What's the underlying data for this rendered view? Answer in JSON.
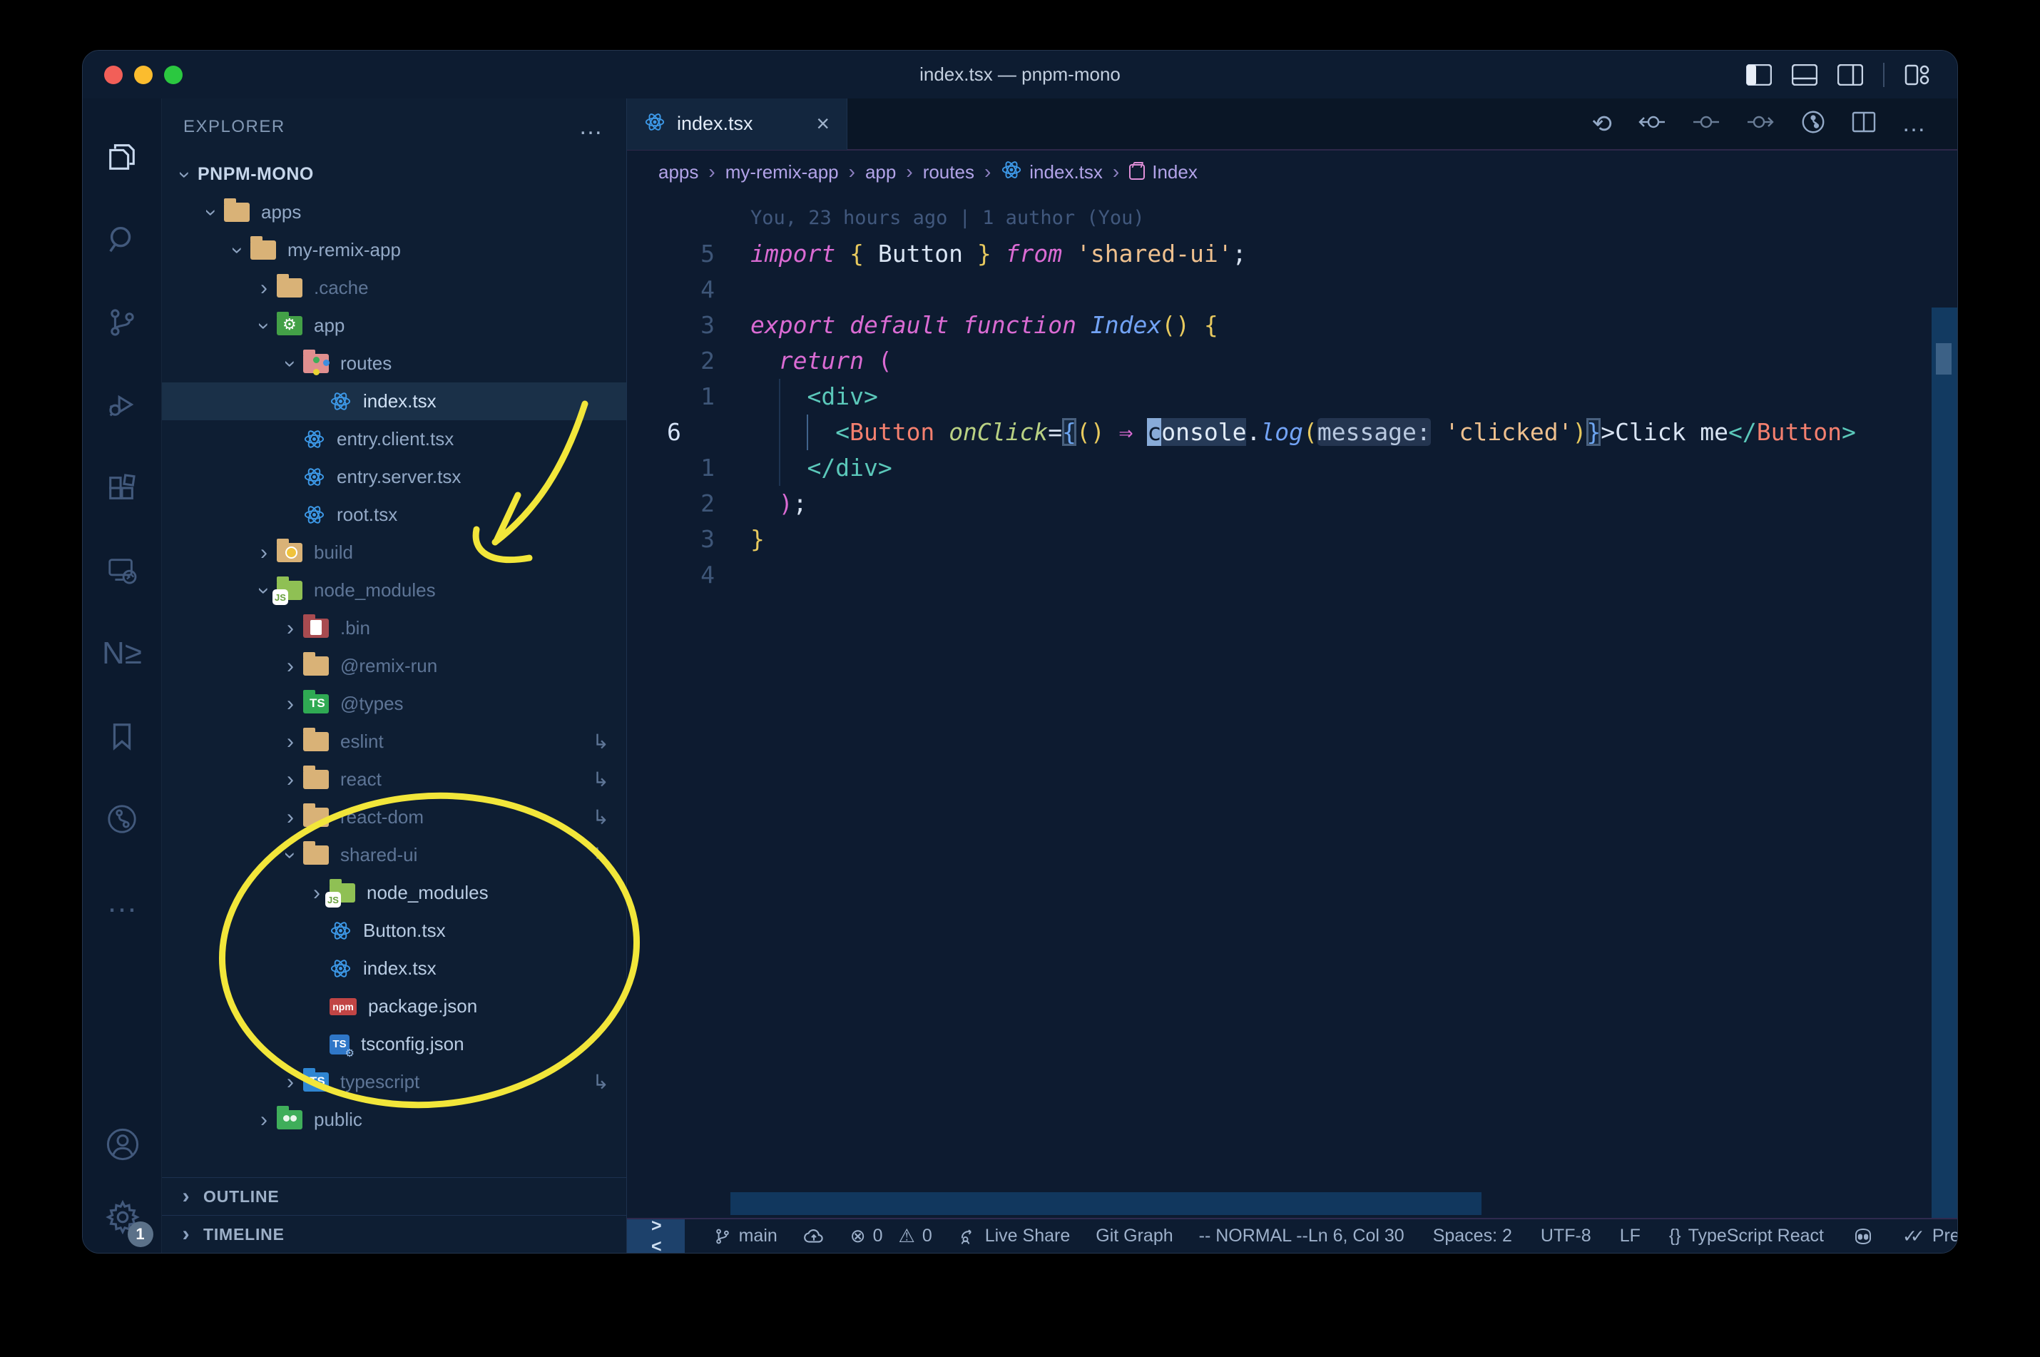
{
  "window": {
    "title": "index.tsx — pnpm-mono"
  },
  "colors": {
    "annotation": "#f2e63a",
    "accent_blue": "#3d99e8",
    "selection": "#1a3048",
    "status_bg": "#0d1c31"
  },
  "icons": {
    "chevron": "›",
    "close": "×",
    "more": "…",
    "more_dots": "…",
    "symlink": "↳",
    "error": "⊗",
    "warning": "⚠",
    "braces": "{}",
    "checks": "✓✓",
    "nx": "N≥",
    "gear": "⚙",
    "js_badge": "JS",
    "ts_badge": "TS",
    "npm_badge": "npm",
    "bin_badge": "0110",
    "history": "⟲"
  },
  "activity": {
    "badge": "1"
  },
  "explorer": {
    "header": "EXPLORER",
    "sections": [
      {
        "label": "OUTLINE"
      },
      {
        "label": "TIMELINE"
      }
    ],
    "items": [
      {
        "label": "PNPM-MONO",
        "icon": "none",
        "level": 0,
        "chevron": "open",
        "root": true
      },
      {
        "label": "apps",
        "icon": "folder-tan",
        "level": 1,
        "chevron": "open"
      },
      {
        "label": "my-remix-app",
        "icon": "folder-tan",
        "level": 2,
        "chevron": "open"
      },
      {
        "label": ".cache",
        "icon": "folder-tan",
        "level": 3,
        "chevron": "closed",
        "dim": true
      },
      {
        "label": "app",
        "icon": "folder-app",
        "level": 3,
        "chevron": "open"
      },
      {
        "label": "routes",
        "icon": "folder-routes",
        "level": 4,
        "chevron": "open"
      },
      {
        "label": "index.tsx",
        "icon": "react",
        "level": 5,
        "chevron": "none",
        "selected": true
      },
      {
        "label": "entry.client.tsx",
        "icon": "react",
        "level": 4,
        "chevron": "none"
      },
      {
        "label": "entry.server.tsx",
        "icon": "react",
        "level": 4,
        "chevron": "none"
      },
      {
        "label": "root.tsx",
        "icon": "react",
        "level": 4,
        "chevron": "none"
      },
      {
        "label": "build",
        "icon": "folder-dist",
        "level": 3,
        "chevron": "closed",
        "dim": true
      },
      {
        "label": "node_modules",
        "icon": "folder-js",
        "level": 3,
        "chevron": "open",
        "dim": true
      },
      {
        "label": ".bin",
        "icon": "folder-bin",
        "level": 4,
        "chevron": "closed",
        "dim": true
      },
      {
        "label": "@remix-run",
        "icon": "folder-tan",
        "level": 4,
        "chevron": "closed",
        "dim": true
      },
      {
        "label": "@types",
        "icon": "folder-ts-green",
        "level": 4,
        "chevron": "closed",
        "dim": true
      },
      {
        "label": "eslint",
        "icon": "folder-tan",
        "level": 4,
        "chevron": "closed",
        "dim": true,
        "symlink": true
      },
      {
        "label": "react",
        "icon": "folder-tan",
        "level": 4,
        "chevron": "closed",
        "dim": true,
        "symlink": true
      },
      {
        "label": "react-dom",
        "icon": "folder-tan",
        "level": 4,
        "chevron": "closed",
        "dim": true,
        "symlink": true
      },
      {
        "label": "shared-ui",
        "icon": "folder-tan",
        "level": 4,
        "chevron": "open",
        "dim": true,
        "symlink": true
      },
      {
        "label": "node_modules",
        "icon": "folder-js",
        "level": 5,
        "chevron": "closed",
        "bright": true
      },
      {
        "label": "Button.tsx",
        "icon": "react",
        "level": 5,
        "chevron": "none",
        "bright": true
      },
      {
        "label": "index.tsx",
        "icon": "react",
        "level": 5,
        "chevron": "none",
        "bright": true
      },
      {
        "label": "package.json",
        "icon": "npm",
        "level": 5,
        "chevron": "none",
        "bright": true
      },
      {
        "label": "tsconfig.json",
        "icon": "tsconfig",
        "level": 5,
        "chevron": "none",
        "bright": true
      },
      {
        "label": "typescript",
        "icon": "folder-ts-blue",
        "level": 4,
        "chevron": "closed",
        "dim": true,
        "symlink": true
      },
      {
        "label": "public",
        "icon": "folder-public",
        "level": 3,
        "chevron": "closed"
      }
    ]
  },
  "editor": {
    "tab": {
      "label": "index.tsx"
    },
    "breadcrumbs": [
      {
        "label": "apps"
      },
      {
        "label": "my-remix-app"
      },
      {
        "label": "app"
      },
      {
        "label": "routes"
      },
      {
        "label": "index.tsx",
        "icon": "react"
      },
      {
        "label": "Index",
        "icon": "symbol"
      }
    ],
    "code": {
      "blame": "You, 23 hours ago | 1 author (You)",
      "lines": [
        {
          "g": "5",
          "tokens": [
            {
              "c": "kw",
              "t": "import"
            },
            {
              "c": "pl",
              "t": " "
            },
            {
              "c": "yb",
              "t": "{"
            },
            {
              "c": "pl",
              "t": " Button "
            },
            {
              "c": "yb",
              "t": "}"
            },
            {
              "c": "pl",
              "t": " "
            },
            {
              "c": "kw",
              "t": "from"
            },
            {
              "c": "pl",
              "t": " "
            },
            {
              "c": "str",
              "t": "'shared-ui'"
            },
            {
              "c": "pl",
              "t": ";"
            }
          ]
        },
        {
          "g": "4",
          "tokens": []
        },
        {
          "g": "3",
          "tokens": [
            {
              "c": "kw",
              "t": "export"
            },
            {
              "c": "pl",
              "t": " "
            },
            {
              "c": "kw",
              "t": "default"
            },
            {
              "c": "pl",
              "t": " "
            },
            {
              "c": "kw",
              "t": "function"
            },
            {
              "c": "pl",
              "t": " "
            },
            {
              "c": "fn",
              "t": "Index"
            },
            {
              "c": "yb",
              "t": "()"
            },
            {
              "c": "pl",
              "t": " "
            },
            {
              "c": "yb",
              "t": "{"
            }
          ]
        },
        {
          "g": "2",
          "tokens": [
            {
              "c": "pl",
              "t": "  "
            },
            {
              "c": "kw",
              "t": "return"
            },
            {
              "c": "pl",
              "t": " "
            },
            {
              "c": "pb",
              "t": "("
            }
          ]
        },
        {
          "g": "1",
          "guides": [
            2
          ],
          "tokens": [
            {
              "c": "pl",
              "t": "    "
            },
            {
              "c": "teal",
              "t": "<div>"
            }
          ]
        },
        {
          "g": "6",
          "current": true,
          "guides": [
            2,
            4
          ],
          "activeGuide": 4,
          "tokens": [
            {
              "c": "pl",
              "t": "      "
            },
            {
              "c": "teal",
              "t": "<"
            },
            {
              "c": "comp",
              "t": "Button"
            },
            {
              "c": "pl",
              "t": " "
            },
            {
              "c": "attr",
              "t": "onClick"
            },
            {
              "c": "pl",
              "t": "="
            },
            {
              "c": "bb",
              "t": "{"
            },
            {
              "c": "yb",
              "t": "()"
            },
            {
              "c": "pl",
              "t": " "
            },
            {
              "c": "arrow",
              "t": "⇒"
            },
            {
              "c": "pl",
              "t": " "
            },
            {
              "c": "cursor",
              "t": "c"
            },
            {
              "c": "whl",
              "t": "onsole"
            },
            {
              "c": "pl",
              "t": "."
            },
            {
              "c": "fn",
              "t": "log"
            },
            {
              "c": "yb",
              "t": "("
            },
            {
              "c": "inlay",
              "t": "message:"
            },
            {
              "c": "pl",
              "t": " "
            },
            {
              "c": "str",
              "t": "'clicked'"
            },
            {
              "c": "yb",
              "t": ")"
            },
            {
              "c": "bb",
              "t": "}"
            },
            {
              "c": "pl",
              "t": ">Click me"
            },
            {
              "c": "teal",
              "t": "</"
            },
            {
              "c": "comp",
              "t": "Button"
            },
            {
              "c": "teal",
              "t": ">"
            }
          ]
        },
        {
          "g": "1",
          "guides": [
            2
          ],
          "tokens": [
            {
              "c": "pl",
              "t": "    "
            },
            {
              "c": "teal",
              "t": "</div>"
            }
          ]
        },
        {
          "g": "2",
          "tokens": [
            {
              "c": "pl",
              "t": "  "
            },
            {
              "c": "pb",
              "t": ")"
            },
            {
              "c": "pl",
              "t": ";"
            }
          ]
        },
        {
          "g": "3",
          "tokens": [
            {
              "c": "yb",
              "t": "}"
            }
          ]
        },
        {
          "g": "4",
          "tokens": []
        }
      ]
    }
  },
  "statusbar": {
    "remote": "><",
    "branch": "main",
    "errors": "0",
    "warnings": "0",
    "live_share": "Live Share",
    "git_graph": "Git Graph",
    "mode": "-- NORMAL --",
    "line_col": "Ln 6, Col 30",
    "spaces": "Spaces: 2",
    "encoding": "UTF-8",
    "eol": "LF",
    "language": "TypeScript React",
    "prettier": "Prettier"
  }
}
